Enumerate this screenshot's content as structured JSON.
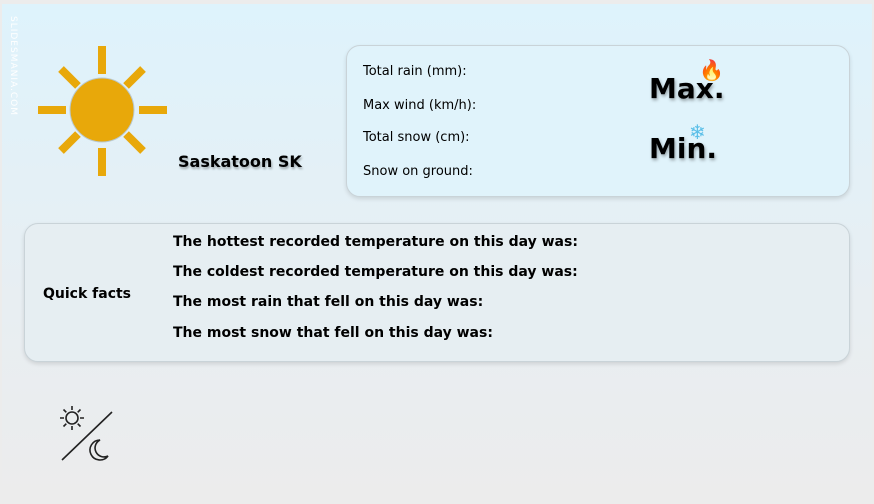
{
  "watermark": "SLIDESMANIA.COM",
  "location": "Saskatoon SK",
  "stats": [
    "Total rain (mm):",
    "Max wind (km/h):",
    "Total snow (cm):",
    "Snow on ground:"
  ],
  "max_label": "Max.",
  "min_label": "Min.",
  "max_icon": "🔥",
  "min_icon": "❄",
  "quick_facts": {
    "title": "Quick facts",
    "items": [
      "The hottest recorded temperature on this day was:",
      "The coldest recorded temperature on this day was:",
      "The most rain that fell on this day was:",
      "The most snow that fell on this day was:"
    ]
  },
  "colors": {
    "sun": "#e8a80a"
  }
}
